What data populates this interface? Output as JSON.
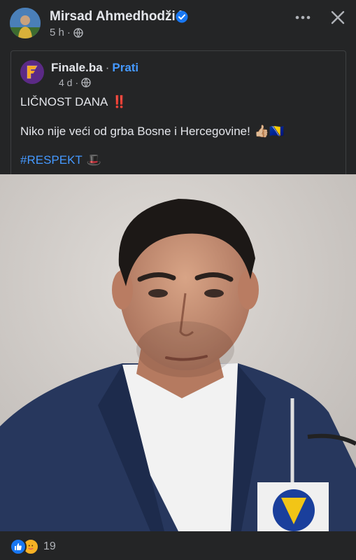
{
  "header": {
    "author_name": "Mirsad Ahmedhodžić",
    "timestamp": "5 h",
    "separator": "·",
    "icons": [
      "verified-badge-icon",
      "globe-icon",
      "more-options-icon",
      "close-icon"
    ]
  },
  "shared_post": {
    "source_name": "Finale.ba",
    "separator": "·",
    "follow_label": "Prati",
    "timestamp": "4 d",
    "meta_separator": "·",
    "title_line": "LIČNOST DANA",
    "title_emoji": "‼️",
    "body_line": "Niko nije veći od grba Bosne i Hercegovine!",
    "body_emojis": "👍🏼🇧🇦",
    "hashtag": "#RESPEKT",
    "hashtag_emoji": "🎩"
  },
  "photo": {
    "subject": "man-in-suit-portrait"
  },
  "reactions": {
    "count": "19",
    "types": [
      "like",
      "care"
    ]
  },
  "colors": {
    "background": "#242526",
    "text_primary": "#e4e6eb",
    "text_secondary": "#b0b3b8",
    "link": "#4599ff",
    "verified": "#1877f2"
  }
}
